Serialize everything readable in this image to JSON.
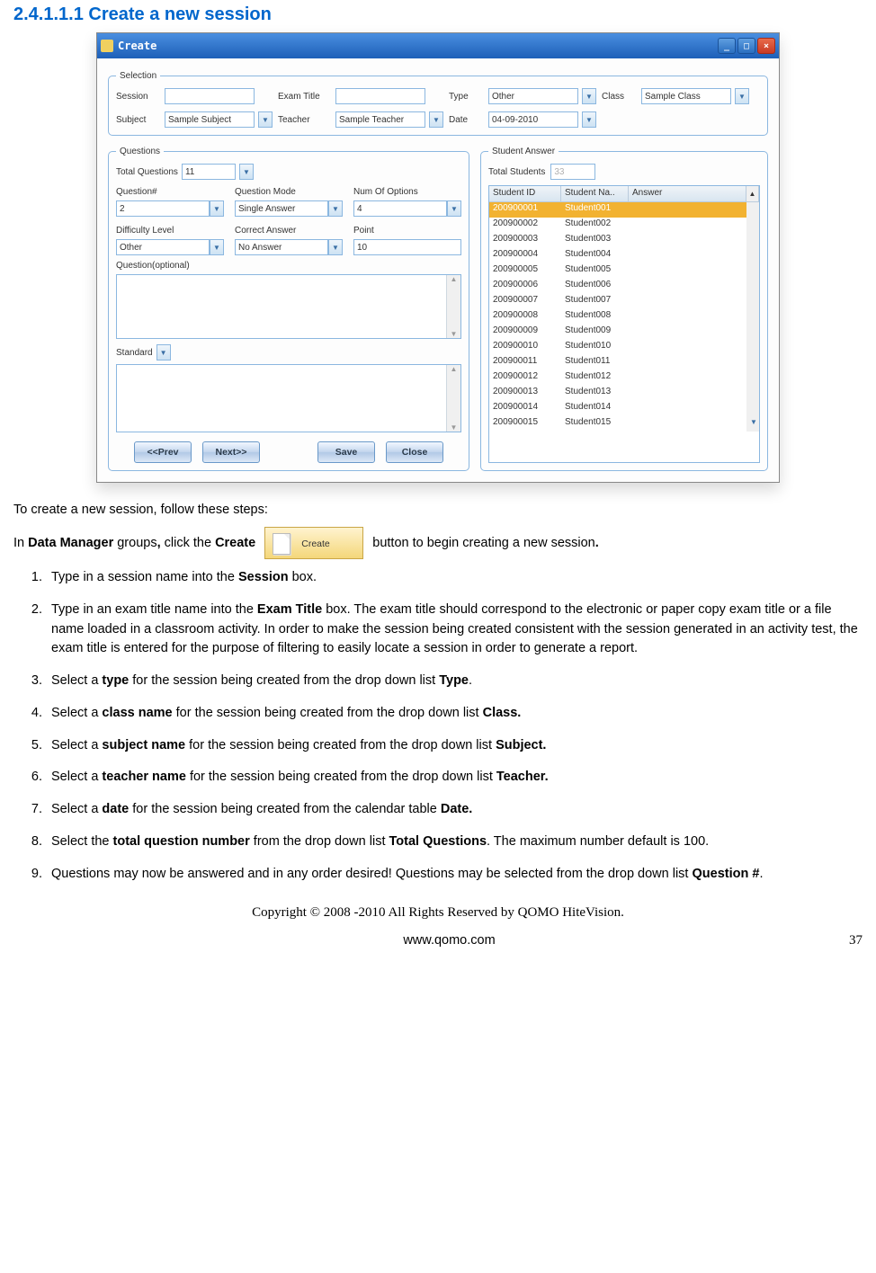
{
  "heading": "2.4.1.1.1  Create a new session",
  "window": {
    "title": "Create",
    "minimize": "_",
    "maximize": "□",
    "close": "×",
    "selection": {
      "legend": "Selection",
      "session_label": "Session",
      "session_value": "",
      "exam_title_label": "Exam Title",
      "exam_title_value": "",
      "type_label": "Type",
      "type_value": "Other",
      "class_label": "Class",
      "class_value": "Sample Class",
      "subject_label": "Subject",
      "subject_value": "Sample Subject",
      "teacher_label": "Teacher",
      "teacher_value": "Sample Teacher",
      "date_label": "Date",
      "date_value": "04-09-2010"
    },
    "questions": {
      "legend": "Questions",
      "total_label": "Total Questions",
      "total_value": "11",
      "qnum_label": "Question#",
      "qnum_value": "2",
      "qmode_label": "Question Mode",
      "qmode_value": "Single Answer",
      "numopt_label": "Num Of Options",
      "numopt_value": "4",
      "diff_label": "Difficulty Level",
      "diff_value": "Other",
      "corr_label": "Correct Answer",
      "corr_value": "No Answer",
      "point_label": "Point",
      "point_value": "10",
      "optional_label": "Question(optional)",
      "standard_label": "Standard"
    },
    "answers": {
      "legend": "Student Answer",
      "total_students_label": "Total Students",
      "total_students_value": "33",
      "col_id": "Student ID",
      "col_name": "Student Na..",
      "col_answer": "Answer",
      "rows": [
        {
          "id": "200900001",
          "name": "Student001"
        },
        {
          "id": "200900002",
          "name": "Student002"
        },
        {
          "id": "200900003",
          "name": "Student003"
        },
        {
          "id": "200900004",
          "name": "Student004"
        },
        {
          "id": "200900005",
          "name": "Student005"
        },
        {
          "id": "200900006",
          "name": "Student006"
        },
        {
          "id": "200900007",
          "name": "Student007"
        },
        {
          "id": "200900008",
          "name": "Student008"
        },
        {
          "id": "200900009",
          "name": "Student009"
        },
        {
          "id": "200900010",
          "name": "Student010"
        },
        {
          "id": "200900011",
          "name": "Student011"
        },
        {
          "id": "200900012",
          "name": "Student012"
        },
        {
          "id": "200900013",
          "name": "Student013"
        },
        {
          "id": "200900014",
          "name": "Student014"
        },
        {
          "id": "200900015",
          "name": "Student015"
        }
      ]
    },
    "buttons": {
      "prev": "<<Prev",
      "next": "Next>>",
      "save": "Save",
      "close": "Close"
    }
  },
  "intro": "To create a new session, follow these steps:",
  "inline": {
    "pre": "In ",
    "dm": "Data Manager",
    "mid1": " groups",
    "comma": ",",
    "mid2": " click the ",
    "create_bold": "Create",
    "btn_label": "Create",
    "post": " button to begin creating a new session",
    "period": "."
  },
  "steps": {
    "s1a": "Type in a session name into the ",
    "s1b": "Session",
    "s1c": " box.",
    "s2a": "Type in an exam title name into the ",
    "s2b": "Exam Title",
    "s2c": " box. The exam title should correspond to the electronic or paper copy exam title or a file name loaded in a classroom activity. In order to make the session being created consistent with the session generated in an activity test, the exam title is entered for the purpose of filtering to easily locate a session in order to generate a report.",
    "s3a": "Select a ",
    "s3b": "type",
    "s3c": " for the session being created from the drop down list ",
    "s3d": "Type",
    "s3e": ".",
    "s4a": "Select a ",
    "s4b": "class name",
    "s4c": " for the session being created from the drop down list ",
    "s4d": "Class.",
    "s5a": "Select a ",
    "s5b": "subject name",
    "s5c": " for the session being created from the drop down list ",
    "s5d": "Subject.",
    "s6a": "Select a ",
    "s6b": "teacher name",
    "s6c": " for the session being created from the drop down list ",
    "s6d": "Teacher.",
    "s7a": "Select a ",
    "s7b": "date",
    "s7c": " for the session being created from the calendar table ",
    "s7d": "Date.",
    "s8a": "Select the ",
    "s8b": "total question number",
    "s8c": " from the drop down list ",
    "s8d": "Total Questions",
    "s8e": ". The maximum number default is 100.",
    "s9a": "Questions may now be answered and in any order desired! Questions may be selected from the drop down list ",
    "s9b": "Question #",
    "s9c": "."
  },
  "footer": {
    "copyright": "Copyright © 2008 -2010 All Rights Reserved by QOMO HiteVision.",
    "url": "www.qomo.com",
    "page": "37"
  }
}
